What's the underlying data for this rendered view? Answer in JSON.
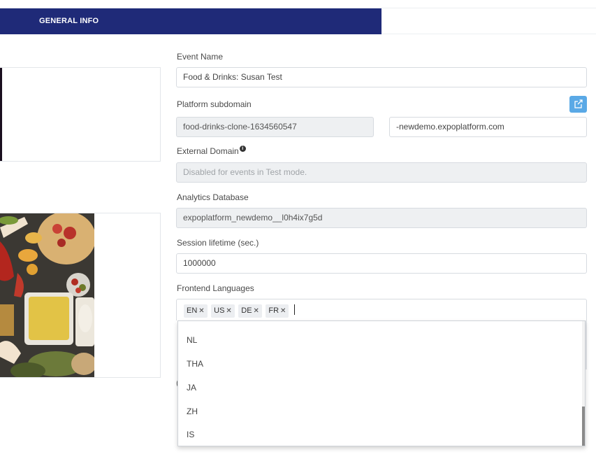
{
  "tabs": {
    "general_info": "GENERAL INFO"
  },
  "form": {
    "event_name": {
      "label": "Event Name",
      "value": "Food & Drinks: Susan Test"
    },
    "platform_subdomain": {
      "label": "Platform subdomain",
      "value": "food-drinks-clone-1634560547",
      "suffix": "-newdemo.expoplatform.com"
    },
    "external_domain": {
      "label": "External Domain",
      "placeholder": "Disabled for events in Test mode."
    },
    "analytics_database": {
      "label": "Analytics Database",
      "value": "expoplatform_newdemo__l0h4ix7g5d"
    },
    "session_lifetime": {
      "label": "Session lifetime (sec.)",
      "value": "1000000"
    },
    "frontend_languages": {
      "label": "Frontend Languages",
      "selected": [
        "EN",
        "US",
        "DE",
        "FR"
      ],
      "options": [
        "NL",
        "THA",
        "JA",
        "ZH",
        "IS"
      ]
    }
  },
  "icons": {
    "external_link": "external-link-icon",
    "info": "info-icon",
    "remove_tag": "close-icon"
  },
  "colors": {
    "tab_active": "#1f2a78",
    "accent_button": "#5aa9e6",
    "disabled_field": "#eef0f2"
  }
}
